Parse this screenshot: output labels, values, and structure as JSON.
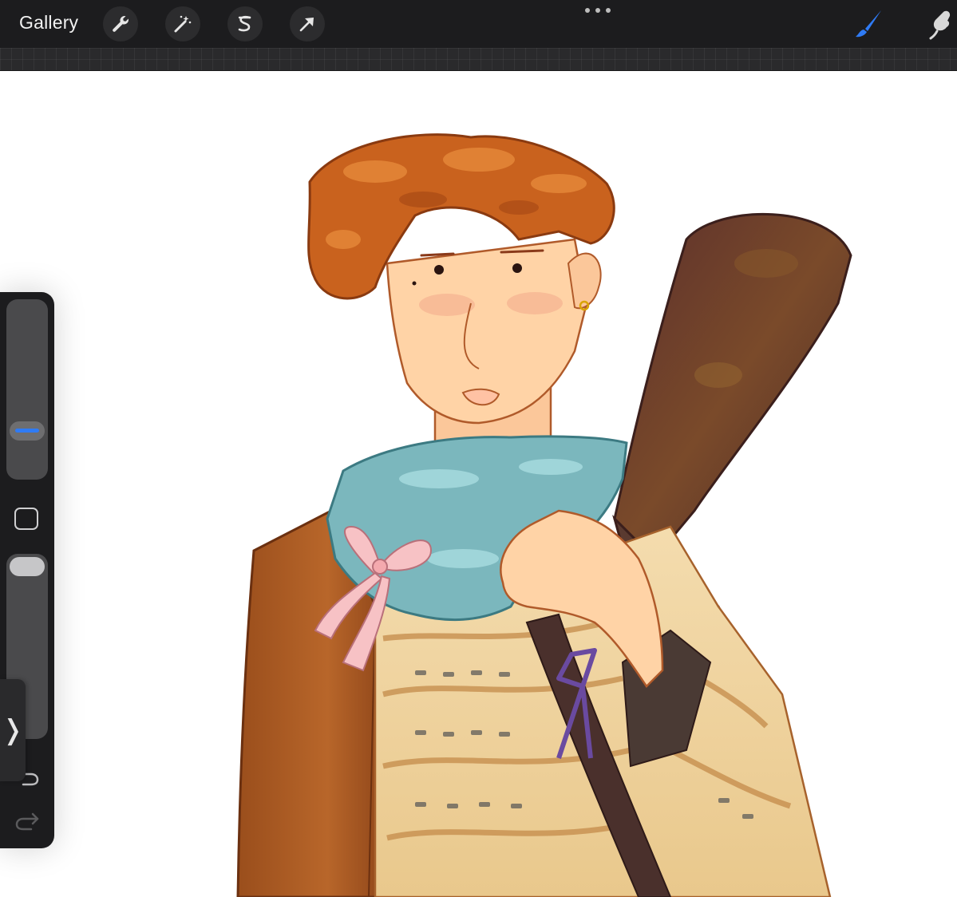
{
  "toolbar": {
    "gallery_label": "Gallery",
    "tools": [
      {
        "name": "actions",
        "icon": "wrench-icon"
      },
      {
        "name": "adjustments",
        "icon": "magic-wand-icon"
      },
      {
        "name": "selection",
        "icon": "selection-s-icon"
      },
      {
        "name": "transform",
        "icon": "arrow-cursor-icon"
      }
    ],
    "more_icon": "ellipsis-icon",
    "right_tools": [
      {
        "name": "brush",
        "icon": "brush-icon",
        "active": true,
        "color": "#2f7bf5"
      },
      {
        "name": "smudge",
        "icon": "smudge-finger-icon",
        "active": false,
        "color": "#d8d8d8"
      }
    ]
  },
  "sidebar": {
    "brush_size_level": 0.23,
    "opacity_level": 1.0,
    "modify_icon": "square-icon",
    "undo_icon": "undo-icon",
    "redo_icon": "redo-icon",
    "collapse_glyph": "❭"
  },
  "colors": {
    "toolbar_bg": "#1c1c1e",
    "accent": "#2f7bf5",
    "canvas_bg": "#ffffff"
  }
}
